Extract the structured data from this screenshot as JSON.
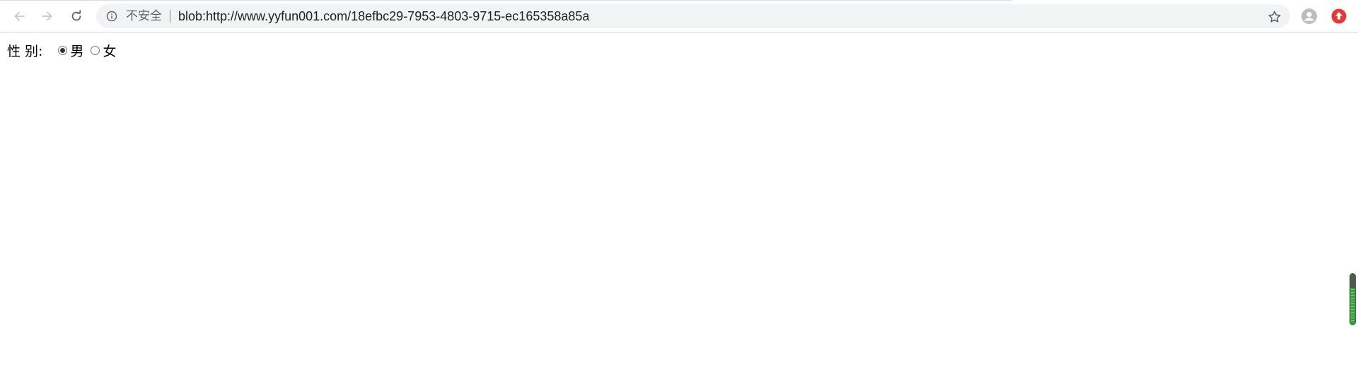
{
  "browser": {
    "security_label": "不安全",
    "url": "blob:http://www.yyfun001.com/18efbc29-7953-4803-9715-ec165358a85a",
    "icons": {
      "back": "arrow-left-icon",
      "forward": "arrow-right-icon",
      "reload": "reload-icon",
      "info": "info-circle-icon",
      "bookmark": "star-icon",
      "profile": "avatar-icon",
      "extension": "upload-extension-icon"
    },
    "colors": {
      "extension_red": "#e53935",
      "omnibox_bg": "#f1f3f4"
    }
  },
  "form": {
    "gender_label": "性 别:",
    "options": [
      {
        "label": "男",
        "checked": true
      },
      {
        "label": "女",
        "checked": false
      }
    ]
  }
}
